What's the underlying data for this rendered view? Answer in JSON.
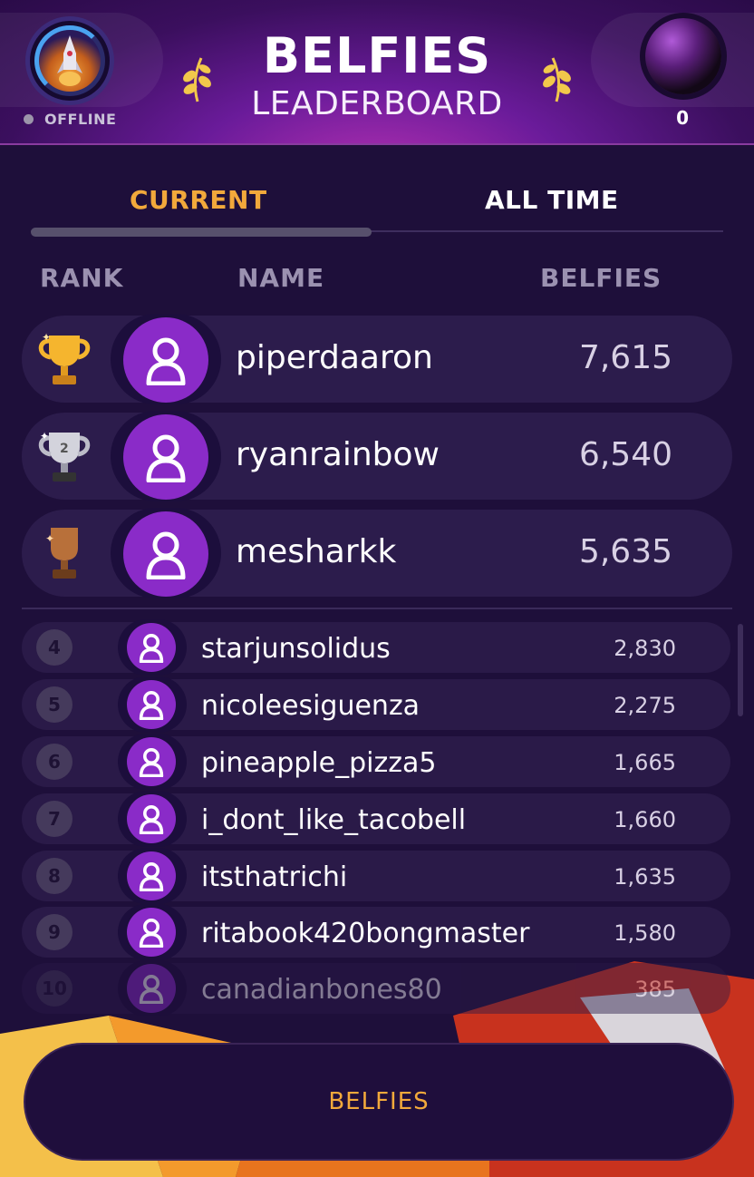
{
  "header": {
    "title": "BELFIES",
    "subtitle": "LEADERBOARD",
    "status": "OFFLINE",
    "points": "0"
  },
  "tabs": {
    "current": "CURRENT",
    "all_time": "ALL TIME",
    "selected": "CURRENT"
  },
  "columns": {
    "rank": "RANK",
    "name": "NAME",
    "belfies": "BELFIES"
  },
  "top3": [
    {
      "rank": "1",
      "trophy": "gold-trophy-icon",
      "name": "piperdaaron",
      "score": "7,615"
    },
    {
      "rank": "2",
      "trophy": "silver-trophy-icon",
      "name": "ryanrainbow",
      "score": "6,540"
    },
    {
      "rank": "3",
      "trophy": "bronze-trophy-icon",
      "name": "mesharkk",
      "score": "5,635"
    }
  ],
  "list": [
    {
      "rank": "4",
      "name": "starjunsolidus",
      "score": "2,830"
    },
    {
      "rank": "5",
      "name": "nicoleesiguenza",
      "score": "2,275"
    },
    {
      "rank": "6",
      "name": "pineapple_pizza5",
      "score": "1,665"
    },
    {
      "rank": "7",
      "name": "i_dont_like_tacobell",
      "score": "1,660"
    },
    {
      "rank": "8",
      "name": "itsthatrichi",
      "score": "1,635"
    },
    {
      "rank": "9",
      "name": "ritabook420bongmaster",
      "score": "1,580"
    },
    {
      "rank": "10",
      "name": "canadianbones80",
      "score": "385"
    }
  ],
  "bottom_button": "BELFIES",
  "colors": {
    "accent": "#f2a93b",
    "avatar": "#8a2bc8",
    "background": "#1e0f3a"
  }
}
